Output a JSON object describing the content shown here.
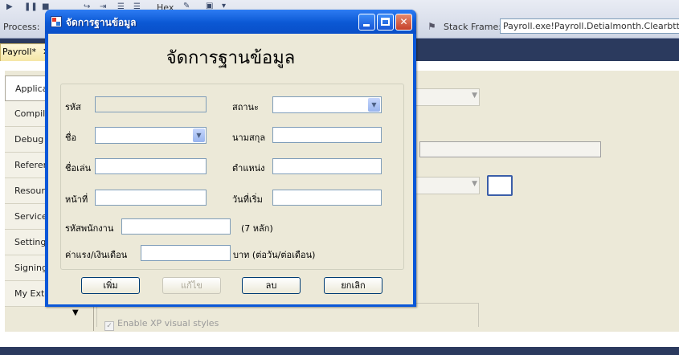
{
  "ide": {
    "hex_label": "Hex",
    "process_label": "Process:",
    "stack_frame_label": "Stack Frame:",
    "stack_frame_value": "Payroll.exe!Payroll.Detialmonth.Clearbtt_Click",
    "document_tab": "Payroll*",
    "document_tab_close": "✕",
    "side_tabs": [
      {
        "label": "Applicat"
      },
      {
        "label": "Compile"
      },
      {
        "label": "Debug"
      },
      {
        "label": "Referen"
      },
      {
        "label": "Resourc"
      },
      {
        "label": "Services"
      },
      {
        "label": "Settings"
      },
      {
        "label": "Signing"
      },
      {
        "label": "My Exte"
      }
    ],
    "xp_styles_label": "Enable XP visual styles"
  },
  "dialog": {
    "title": "จัดการฐานข้อมูล",
    "heading": "จัดการฐานข้อมูล",
    "fields": {
      "code_label": "รหัส",
      "code_value": "",
      "status_label": "สถานะ",
      "status_value": "",
      "name_label": "ชื่อ",
      "name_value": "",
      "surname_label": "นามสกุล",
      "surname_value": "",
      "nickname_label": "ชื่อเล่น",
      "nickname_value": "",
      "position_label": "ตำแหน่ง",
      "position_value": "",
      "duty_label": "หน้าที่",
      "duty_value": "",
      "start_date_label": "วันที่เริ่ม",
      "start_date_value": "",
      "employee_id_label": "รหัสพนักงาน",
      "employee_id_value": "",
      "employee_id_hint": "(7 หลัก)",
      "wage_label": "ค่าแรง/เงินเดือน",
      "wage_value": "",
      "wage_unit": "บาท (ต่อวัน/ต่อเดือน)"
    },
    "buttons": {
      "add": "เพิ่ม",
      "edit": "แก้ไข",
      "delete": "ลบ",
      "cancel": "ยกเลิก"
    }
  }
}
